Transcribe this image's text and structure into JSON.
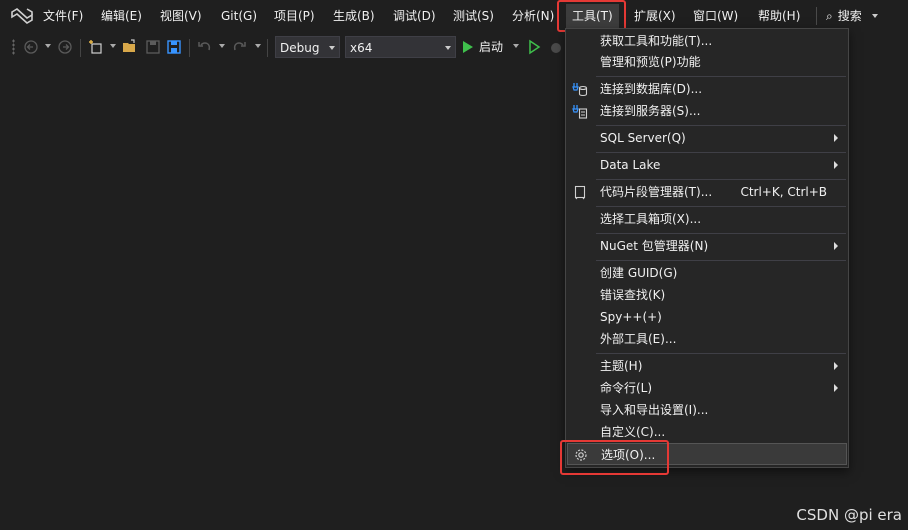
{
  "menubar": {
    "items": [
      {
        "label": "文件(F)"
      },
      {
        "label": "编辑(E)"
      },
      {
        "label": "视图(V)"
      },
      {
        "label": "Git(G)"
      },
      {
        "label": "项目(P)"
      },
      {
        "label": "生成(B)"
      },
      {
        "label": "调试(D)"
      },
      {
        "label": "测试(S)"
      },
      {
        "label": "分析(N)"
      },
      {
        "label": "工具(T)"
      },
      {
        "label": "扩展(X)"
      },
      {
        "label": "窗口(W)"
      },
      {
        "label": "帮助(H)"
      }
    ],
    "search_label": "搜索"
  },
  "toolbar": {
    "config": "Debug",
    "platform": "x64",
    "start_label": "启动"
  },
  "tools_menu": {
    "items": [
      {
        "label": "获取工具和功能(T)..."
      },
      {
        "label": "管理和预览(P)功能"
      },
      {
        "label": "连接到数据库(D)..."
      },
      {
        "label": "连接到服务器(S)..."
      },
      {
        "label": "SQL Server(Q)"
      },
      {
        "label": "Data Lake"
      },
      {
        "label": "代码片段管理器(T)...",
        "shortcut": "Ctrl+K, Ctrl+B"
      },
      {
        "label": "选择工具箱项(X)..."
      },
      {
        "label": "NuGet 包管理器(N)"
      },
      {
        "label": "创建 GUID(G)"
      },
      {
        "label": "错误查找(K)"
      },
      {
        "label": "Spy++(+)"
      },
      {
        "label": "外部工具(E)..."
      },
      {
        "label": "主题(H)"
      },
      {
        "label": "命令行(L)"
      },
      {
        "label": "导入和导出设置(I)..."
      },
      {
        "label": "自定义(C)..."
      },
      {
        "label": "选项(O)..."
      }
    ]
  },
  "colors": {
    "highlight": "#e53935",
    "play": "#3fbf4c",
    "accent": "#3794ff"
  },
  "watermark": "CSDN @pi era"
}
